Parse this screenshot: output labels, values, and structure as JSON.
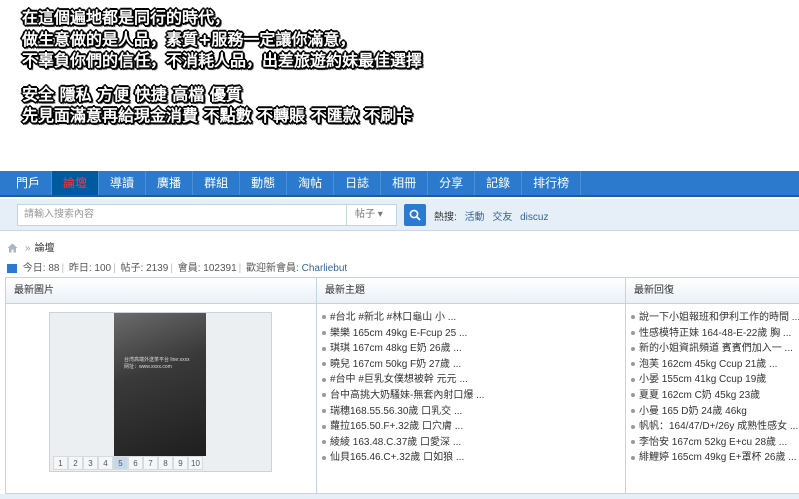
{
  "banner": {
    "lines": [
      "在這個遍地都是同行的時代，",
      "做生意做的是人品，素質+服務一定讓你滿意，",
      "不辜負你們的信任，不消耗人品，出差旅遊約妹最佳選擇",
      "安全 隱私 方便 快捷 高檔 優質",
      "先見面滿意再給現金消費  不點數 不轉賬 不匯款 不刷卡"
    ]
  },
  "nav": {
    "items": [
      "門戶",
      "論壇",
      "導讀",
      "廣播",
      "群組",
      "動態",
      "淘帖",
      "日誌",
      "相冊",
      "分享",
      "記錄",
      "排行榜"
    ],
    "active_index": 1
  },
  "search": {
    "placeholder": "請輸入搜索內容",
    "type_label": "帖子 ▾",
    "hot_label": "熱搜:",
    "hot_items": [
      "活動",
      "交友",
      "discuz"
    ]
  },
  "breadcrumb": {
    "home_icon": "home-icon",
    "current": "論壇"
  },
  "stats": {
    "today_label": "今日:",
    "today": "88",
    "yesterday_label": "昨日:",
    "yesterday": "100",
    "posts_label": "帖子:",
    "posts": "2139",
    "members_label": "會員:",
    "members": "102391",
    "welcome_label": "歡迎新會員:",
    "newest_member": "Charliebut"
  },
  "panels": {
    "images_title": "最新圖片",
    "topics_title": "最新主題",
    "replies_title": "最新回復",
    "slide_caption_1": "台湾高端外送茶平台 line:xxxx",
    "slide_caption_2": "网址：www.xxxx.com",
    "pager": [
      "1",
      "2",
      "3",
      "4",
      "5",
      "6",
      "7",
      "8",
      "9",
      "10"
    ],
    "pager_active": 4,
    "topics": [
      "#台北 #新北 #林口龜山 小 ...",
      "樂樂 165cm 49kg E-Fcup 25 ...",
      "琪琪 167cm 48kg E奶 26歲 ...",
      "曉兒 167cm 50kg F奶 27歲 ...",
      "#台中 #巨乳女僕想被幹 元元 ...",
      "台中高挑大奶騷妹-無套內射口爆 ...",
      "瑞穗168.55.56.30歲 口乳交 ...",
      "蘿拉165.50.F+.32歲 口穴膚 ...",
      "綾綾 163.48.C.37歲 口愛深 ...",
      "仙貝165.46.C+.32歲 口如狼 ..."
    ],
    "replies": [
      "說一下小姐報班和伊利工作的時間 ...",
      "性感模特正妹 164-48-E-22歲 胸 ...",
      "新的小姐資訊頻道 賓賓們加入一 ...",
      "泡芙 162cm 45kg Ccup 21歲 ...",
      "小晏 155cm 41kg Ccup 19歲",
      "夏夏 162cm C奶 45kg 23歲",
      "小曼 165 D奶 24歲 46kg",
      "帆帆：164/47/D+/26y 成熟性感女 ...",
      "李怡安 167cm 52kg E+cu 28歲 ...",
      "緋鯉婷 165cm 49kg E+罩杯 26歲 ..."
    ]
  },
  "colors": {
    "nav_bg": "#2b7acd",
    "nav_active_text": "#ff3333",
    "link": "#336699"
  }
}
